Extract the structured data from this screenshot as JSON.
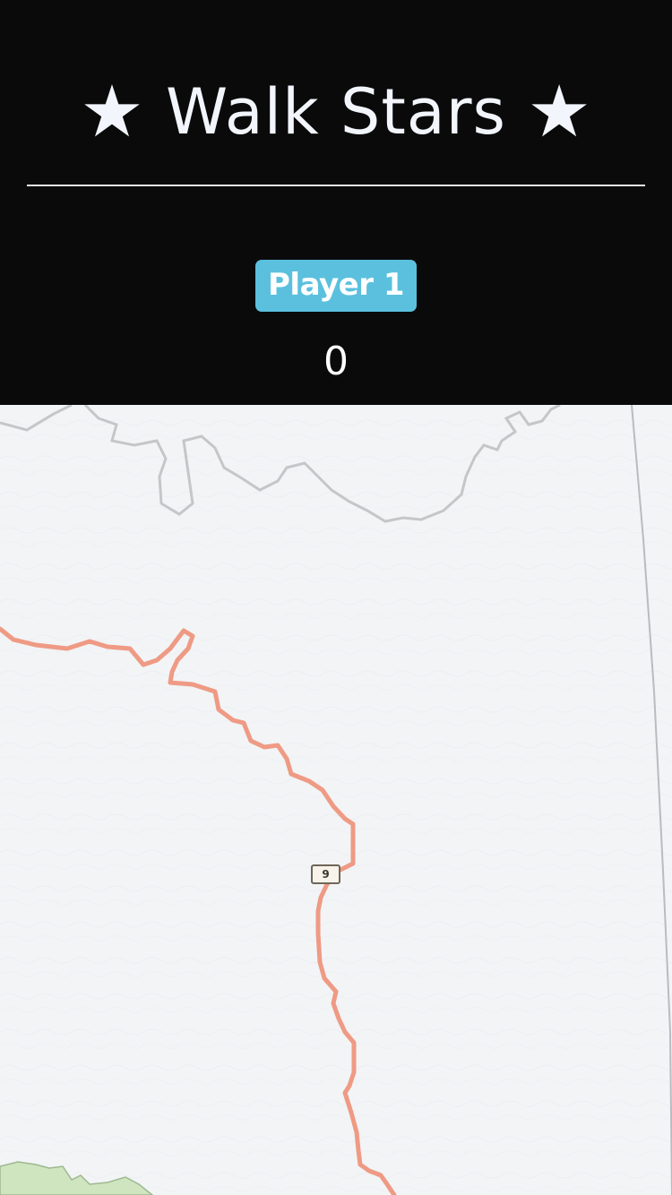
{
  "app": {
    "title": "Walk Stars",
    "title_star_left": "★",
    "title_star_right": "★"
  },
  "player": {
    "badge_label": "Player 1",
    "score": "0"
  },
  "map": {
    "route_shield_label": "9",
    "colors": {
      "background": "#f2f4f6",
      "route": "#ef9a84",
      "boundary": "#bdbdbd",
      "park": "#cfe5c0"
    }
  },
  "colors": {
    "header_bg": "#0a0a0b",
    "title_text": "#f2f6fc",
    "badge_bg": "#5bc0de",
    "badge_text": "#ffffff"
  }
}
